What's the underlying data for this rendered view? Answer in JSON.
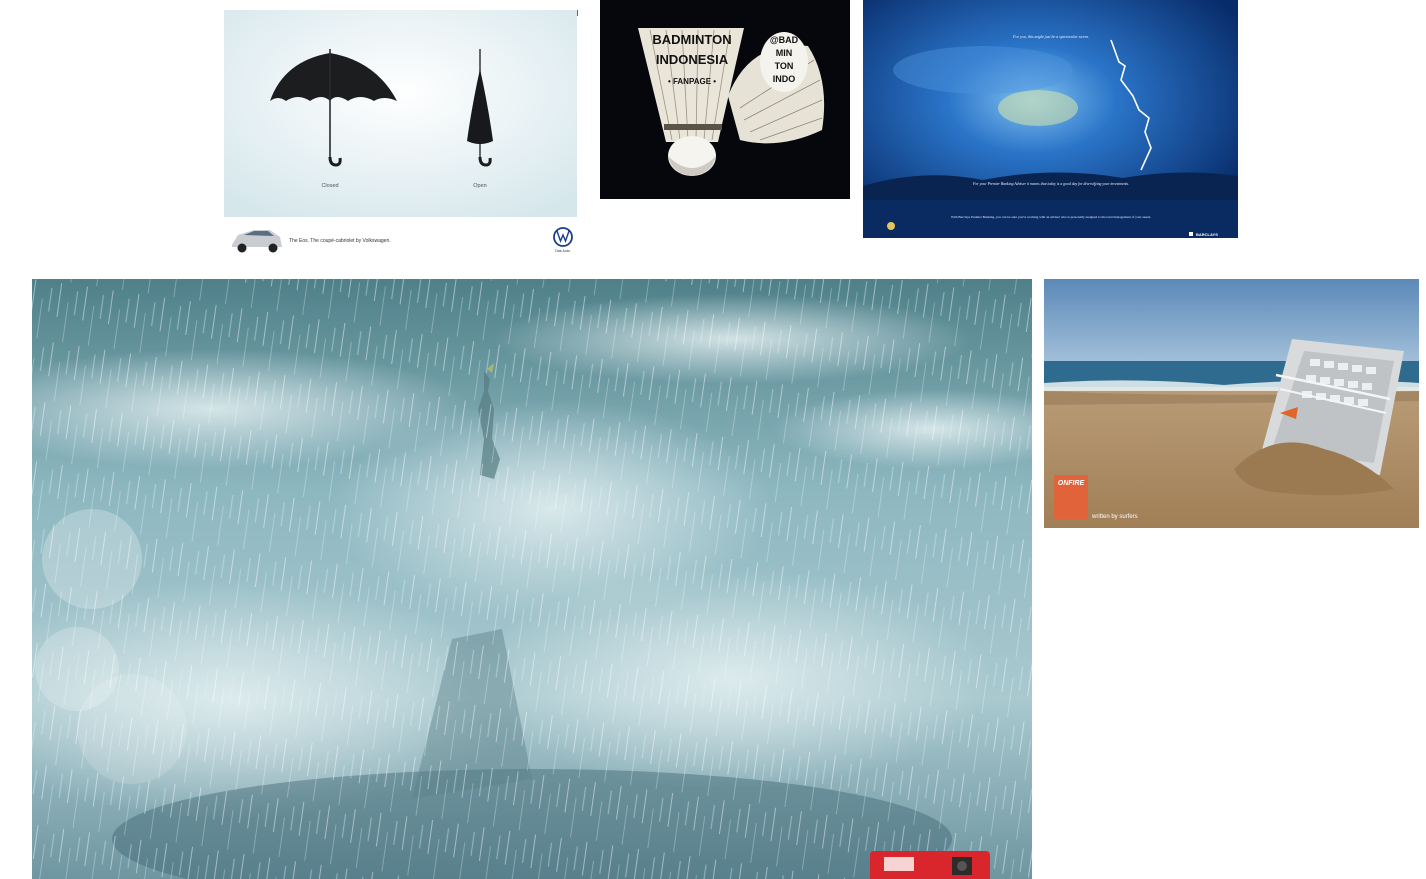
{
  "gallery": {
    "tiles": [
      {
        "id": "vw",
        "umbrella_closed_label": "Closed",
        "umbrella_open_label": "Open",
        "tagline": "The Eos. The coupé-cabriolet by Volkswagen.",
        "brand_sub": "Das Auto."
      },
      {
        "id": "badminton",
        "title_line1": "BADMINTON",
        "title_line2": "INDONESIA",
        "subtitle": "• FANPAGE •",
        "handle_line1": "@BAD",
        "handle_line2": "MIN",
        "handle_line3": "TON",
        "handle_line4": "INDO"
      },
      {
        "id": "barclays",
        "headline": "For you, this might just be a spectacular storm.",
        "subline": "For your Premier Banking Adviser it means that today is a good day for diversifying your investments.",
        "body": "With Barclays Premier Banking, you can be sure you're working with an adviser who is personally assigned to the total management of your assets.",
        "brand": "BARCLAYS"
      },
      {
        "id": "rain"
      },
      {
        "id": "beach",
        "logo_text": "ONFIRE",
        "credit": "written by surfers"
      }
    ]
  },
  "colors": {
    "vw_blue": "#1b3f8f",
    "barclays_blue": "#0d3e8a",
    "camera_red": "#d9262c"
  }
}
